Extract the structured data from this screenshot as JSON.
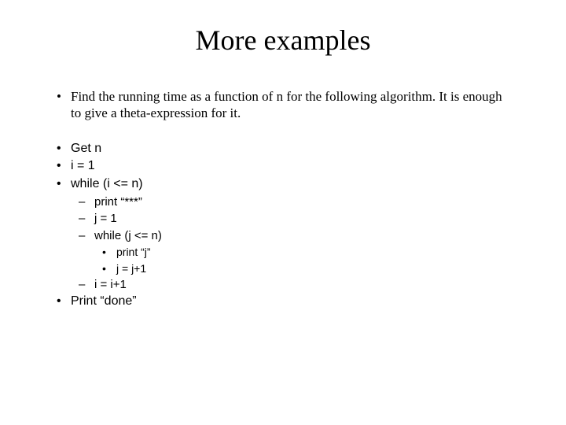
{
  "title": "More examples",
  "intro": "Find the running time as a function of n for the following algorithm. It is enough to give a theta-expression for it.",
  "alg": {
    "l1": "Get n",
    "l2": "i =  1",
    "l3": "while (i <= n)",
    "l4": "print “***”",
    "l5": "j = 1",
    "l6": "while (j <= n)",
    "l7": "print “j”",
    "l8": "j = j+1",
    "l9": "i = i+1",
    "l10": "Print “done”"
  }
}
